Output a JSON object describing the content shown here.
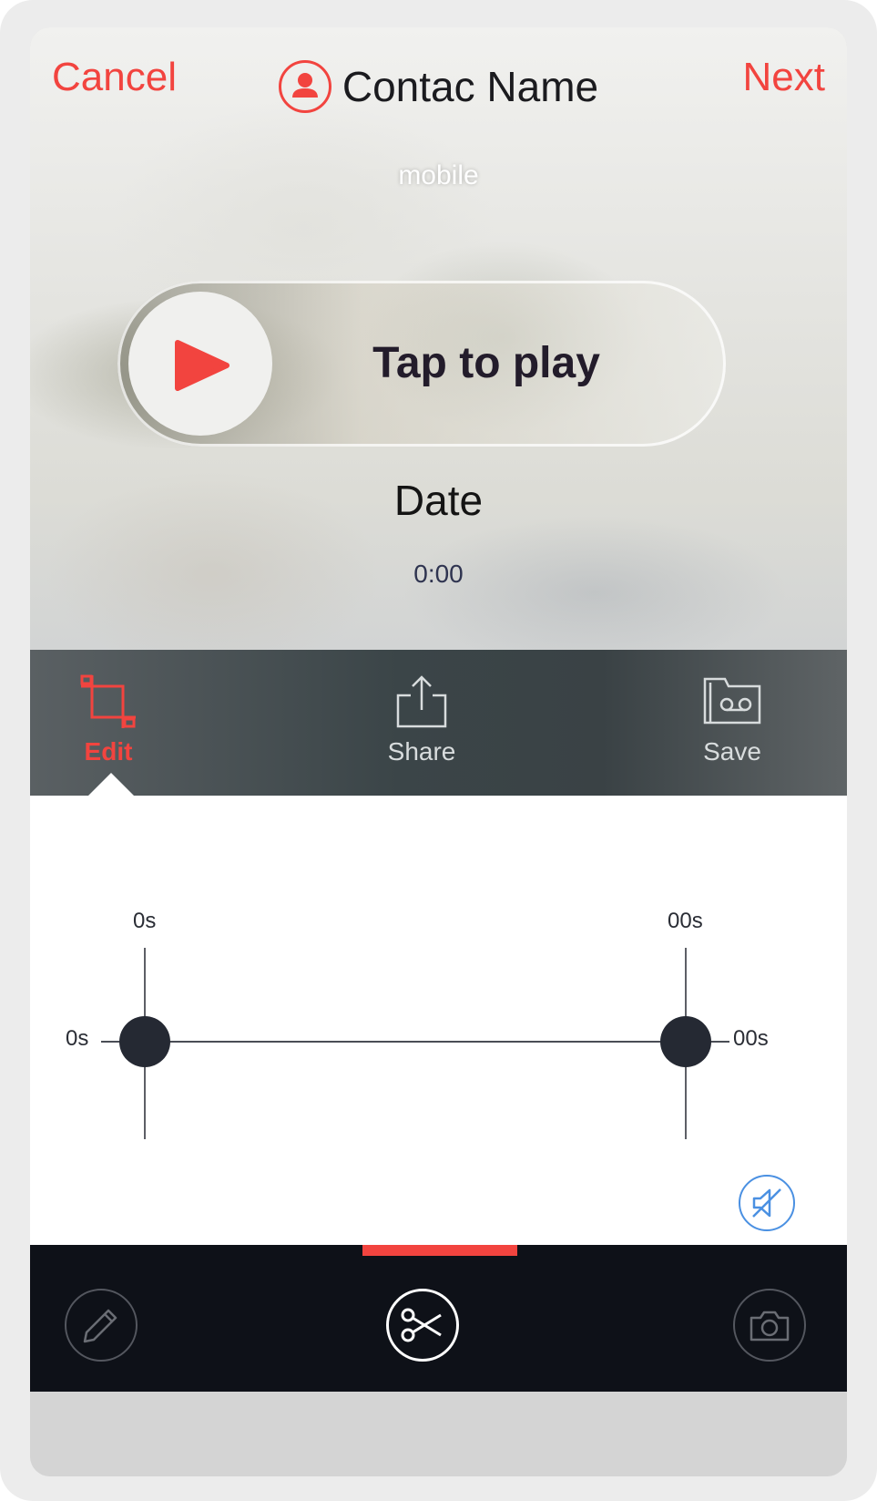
{
  "nav": {
    "cancel_label": "Cancel",
    "next_label": "Next",
    "contact_name": "Contac Name",
    "contact_icon": "person-icon",
    "subtitle": "mobile"
  },
  "player": {
    "play_icon": "play-icon",
    "tap_label": "Tap to play",
    "date_label": "Date",
    "time": "0:00"
  },
  "tabs": [
    {
      "label": "Edit",
      "icon": "crop-icon",
      "active": true
    },
    {
      "label": "Share",
      "icon": "share-icon",
      "active": false
    },
    {
      "label": "Save",
      "icon": "voicemail-folder-icon",
      "active": false
    }
  ],
  "editor": {
    "start_top_label": "0s",
    "end_top_label": "00s",
    "start_side_label": "0s",
    "end_side_label": "00s",
    "mute_icon": "speaker-off-icon"
  },
  "toolbar": {
    "tools": [
      {
        "icon": "pencil-icon",
        "selected": false
      },
      {
        "icon": "scissors-icon",
        "selected": true
      },
      {
        "icon": "camera-icon",
        "selected": false
      }
    ]
  },
  "colors": {
    "accent": "#f2443f",
    "dark": "#0e1118",
    "knob": "#252933",
    "mute_blue": "#4a90e2"
  }
}
